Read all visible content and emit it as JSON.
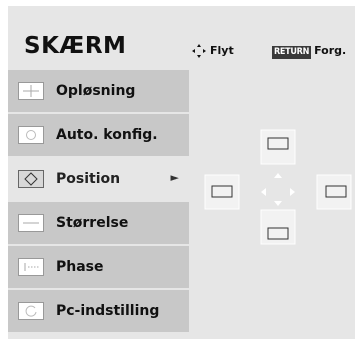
{
  "header": {
    "title": "SKÆRM",
    "move_label": "Flyt",
    "move_icon": "four-way-arrow-icon",
    "return_key": "RETURN",
    "return_label": "Forg."
  },
  "menu": {
    "items": [
      {
        "label": "Opløsning",
        "icon": "resolution-icon",
        "selected": false
      },
      {
        "label": "Auto. konfig.",
        "icon": "auto-config-icon",
        "selected": false
      },
      {
        "label": "Position",
        "icon": "position-icon",
        "selected": true
      },
      {
        "label": "Størrelse",
        "icon": "size-icon",
        "selected": false
      },
      {
        "label": "Phase",
        "icon": "phase-icon",
        "selected": false
      },
      {
        "label": "Pc-indstilling",
        "icon": "pc-setting-icon",
        "selected": false
      }
    ],
    "selected_arrow": "►"
  },
  "colors": {
    "background": "#e6e6e6",
    "item_background": "#c8c8c8",
    "text": "#111111"
  }
}
